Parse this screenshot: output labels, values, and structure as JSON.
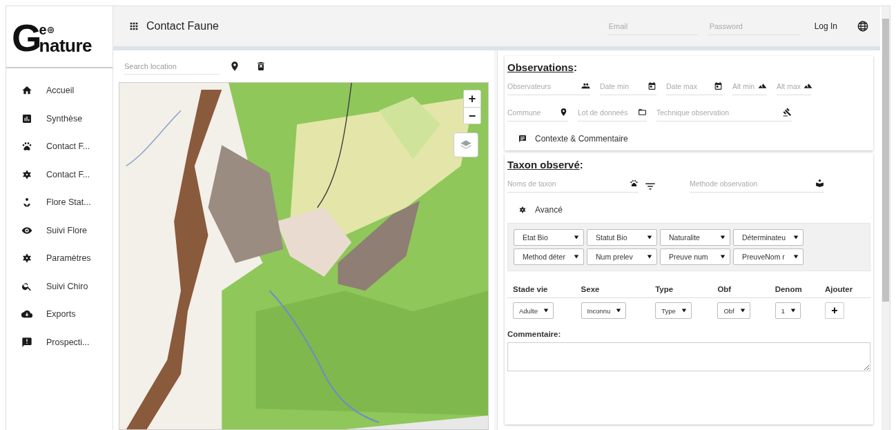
{
  "logo": {
    "initial": "G",
    "top": "e",
    "bottom": "nature"
  },
  "header": {
    "title": "Contact Faune",
    "email_placeholder": "Email",
    "password_placeholder": "Password",
    "login": "Log In"
  },
  "sidebar": {
    "items": [
      {
        "label": "Accueil"
      },
      {
        "label": "Synthèse"
      },
      {
        "label": "Contact F..."
      },
      {
        "label": "Contact F..."
      },
      {
        "label": "Flore Stat..."
      },
      {
        "label": "Suivi Flore"
      },
      {
        "label": "Paramètres"
      },
      {
        "label": "Suivi Chiro"
      },
      {
        "label": "Exports"
      },
      {
        "label": "Prospecti..."
      }
    ]
  },
  "map": {
    "search_placeholder": "Search location",
    "zoom_in": "+",
    "zoom_out": "−"
  },
  "observations": {
    "title": "Observations",
    "suffix": ":",
    "row_1": [
      {
        "placeholder": "Observateurs"
      },
      {
        "placeholder": "Date min"
      },
      {
        "placeholder": "Date max"
      },
      {
        "placeholder": "Alt min"
      },
      {
        "placeholder": "Alt max"
      }
    ],
    "row_2": [
      {
        "placeholder": "Commune"
      },
      {
        "placeholder": "Lot de donneés"
      },
      {
        "placeholder": "Technique observation"
      }
    ],
    "context_button": "Contexte & Commentaire"
  },
  "taxon": {
    "title": "Taxon observé",
    "suffix": ":",
    "fields": [
      {
        "placeholder": "Noms de taxon"
      },
      {
        "placeholder": "Methode observation"
      }
    ],
    "advanced_button": "Avancé",
    "selects": [
      "Etat Bio",
      "Statut Bio",
      "Naturalite",
      "Déterminateu",
      "Method déter",
      "Num prelev",
      "Preuve num",
      "PreuveNom r"
    ],
    "table": {
      "columns": [
        "Stade vie",
        "Sexe",
        "Type",
        "Obf",
        "Denom",
        "Ajouter"
      ],
      "row": [
        "Adulte",
        "Inconnu",
        "Type",
        "Obf",
        "1"
      ],
      "add": "+"
    },
    "comment_label": "Commentaire:"
  }
}
